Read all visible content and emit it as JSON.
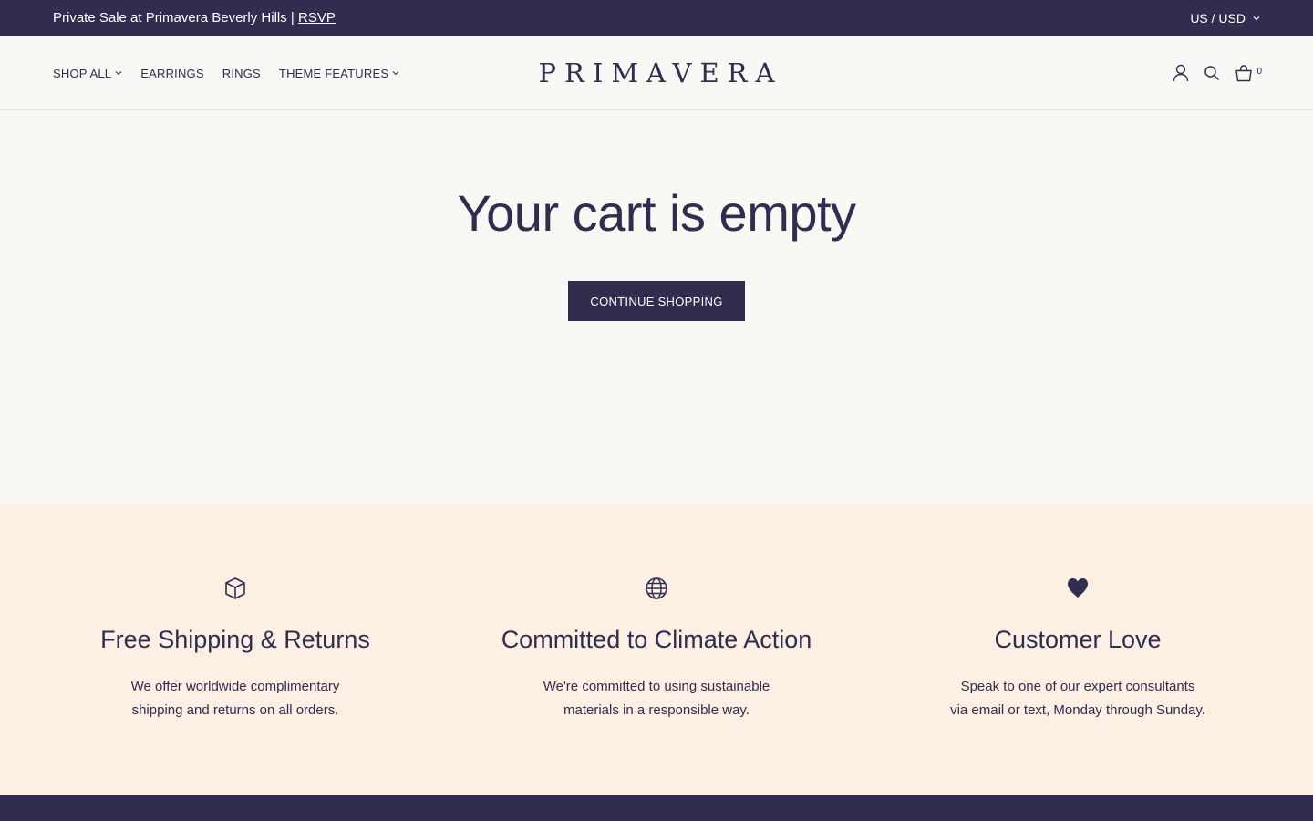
{
  "announcement": {
    "text": "Private Sale at Primavera Beverly Hills |",
    "link": "RSVP",
    "locale": "US / USD"
  },
  "nav": {
    "items": [
      {
        "label": "SHOP ALL"
      },
      {
        "label": "EARRINGS"
      },
      {
        "label": "RINGS"
      },
      {
        "label": "THEME FEATURES"
      }
    ]
  },
  "logo": "PRIMAVERA",
  "header": {
    "cart_count": "0"
  },
  "cart": {
    "heading": "Your cart is empty",
    "button": "CONTINUE SHOPPING"
  },
  "features": [
    {
      "icon": "box-icon",
      "title": "Free Shipping & Returns",
      "line1": "We offer worldwide complimentary",
      "line2": "shipping and returns on all orders."
    },
    {
      "icon": "globe-icon",
      "title": "Committed to Climate Action",
      "line1": "We're committed to using sustainable",
      "line2": "materials in a responsible way."
    },
    {
      "icon": "heart-icon",
      "title": "Customer Love",
      "line1": "Speak to one of our expert consultants",
      "line2": "via email or text, Monday through Sunday."
    }
  ],
  "colors": {
    "primary": "#302d4e",
    "background": "#faf8f5",
    "features_background": "#fcf0e4"
  }
}
